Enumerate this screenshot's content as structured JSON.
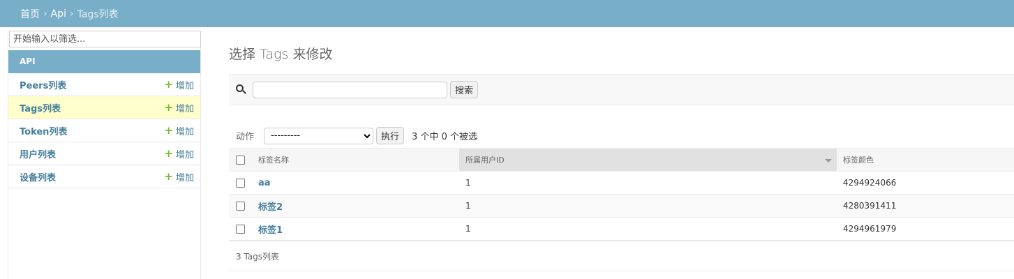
{
  "breadcrumb": {
    "home": "首页",
    "app": "Api",
    "current": "Tags列表",
    "sep": "›"
  },
  "sidebar": {
    "filter_placeholder": "开始输入以筛选...",
    "module": "API",
    "add_label": "增加",
    "plus": "+",
    "items": [
      {
        "label": "Peers列表"
      },
      {
        "label": "Tags列表",
        "active": true
      },
      {
        "label": "Token列表"
      },
      {
        "label": "用户列表"
      },
      {
        "label": "设备列表"
      }
    ]
  },
  "main": {
    "title": "选择 Tags 来修改",
    "search_button": "搜索",
    "action_label": "动作",
    "action_selected": "---------",
    "go_button": "执行",
    "counter": "3 个中 0 个被选",
    "columns": [
      "标签名称",
      "所属用户ID",
      "标签颜色"
    ],
    "rows": [
      {
        "name": "aa",
        "user_id": "1",
        "color": "4294924066"
      },
      {
        "name": "标签2",
        "user_id": "1",
        "color": "4280391411"
      },
      {
        "name": "标签1",
        "user_id": "1",
        "color": "4294961979"
      }
    ],
    "paginator": "3 Tags列表"
  },
  "colors": {
    "header": "#79aec8",
    "link": "#447e9b",
    "add_plus": "#70bf2b",
    "active_row": "#ffffcc"
  }
}
